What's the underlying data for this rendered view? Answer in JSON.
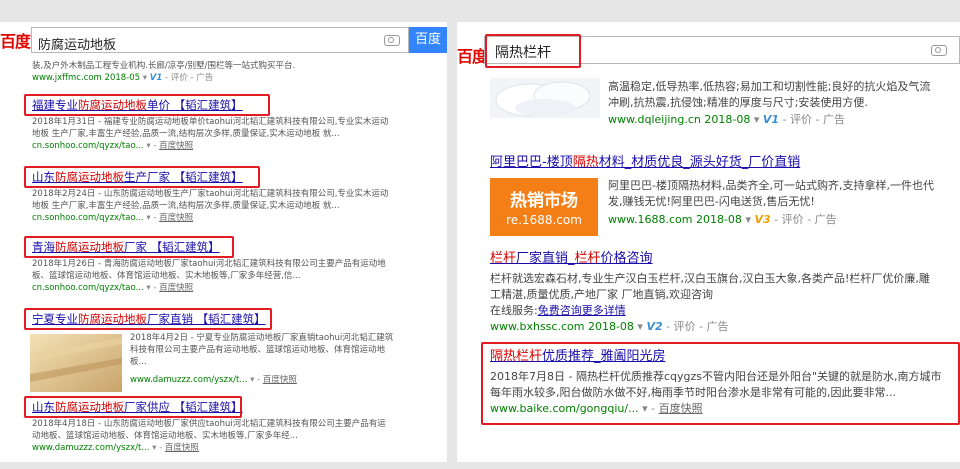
{
  "left": {
    "logo": "百度",
    "query": "防腐运动地板",
    "search_button": "百度一",
    "top_desc": "装,及户外木制品工程专业机构.长廊/凉亭/别墅/围栏等一站式购买平台.",
    "top_url": "www.jxffmc.com",
    "top_date": "2018-05",
    "top_v": "V1",
    "top_extra": "- 评价 - 广告",
    "results": [
      {
        "title_a": "福建专业",
        "title_hl": "防腐运动地板",
        "title_b": "单价 【韬汇建筑】",
        "desc1": "2018年1月31日 - 福建专业防腐运动地板单价taohui河北韬汇建筑科技有限公司,专业实木运动",
        "desc2": "地板 生产厂家,丰富生产经验,品质一流,结构层次多样,质量保证,实木运动地板 就...",
        "url": "cn.sonhoo.com/qyzx/tao...",
        "kz": "百度快照"
      },
      {
        "title_a": "山东",
        "title_hl": "防腐运动地板",
        "title_b": "生产厂家 【韬汇建筑】",
        "desc1": "2018年2月24日 - 山东防腐运动地板生产厂家taohui河北韬汇建筑科技有限公司,专业实木运动",
        "desc2": "地板 生产厂家,丰富生产经验,品质一流,结构层次多样,质量保证,实木运动地板 就...",
        "url": "cn.sonhoo.com/qyzx/tao...",
        "kz": "百度快照"
      },
      {
        "title_a": "青海",
        "title_hl": "防腐运动地板",
        "title_b": "厂家 【韬汇建筑】",
        "desc1": "2018年1月26日 - 青海防腐运动地板厂家taohui河北韬汇建筑科技有限公司主要产品有运动地",
        "desc2": "板、篮球馆运动地板、体育馆运动地板、实木地板等,厂家多年经营,信...",
        "url": "cn.sonhoo.com/qyzx/tao...",
        "kz": "百度快照"
      },
      {
        "title_a": "宁夏专业",
        "title_hl": "防腐运动地板",
        "title_b": "厂家直销 【韬汇建筑】",
        "desc1": "2018年4月2日 - 宁夏专业防腐运动地板厂家直销taohui河北韬汇建筑",
        "desc2": "科技有限公司主要产品有运动地板、篮球馆运动地板、体育馆运动地",
        "desc3": "板...",
        "url": "www.damuzzz.com/yszx/t...",
        "kz": "百度快照"
      },
      {
        "title_a": "山东",
        "title_hl": "防腐运动地板",
        "title_b": "厂家供应 【韬汇建筑】",
        "desc1": "2018年4月18日 - 山东防腐运动地板厂家供应taohui河北韬汇建筑科技有限公司主要产品有运",
        "desc2": "动地板、篮球馆运动地板、体育馆运动地板、实木地板等,厂家多年经...",
        "url": "www.damuzzz.com/yszx/t...",
        "kz": "百度快照"
      }
    ]
  },
  "right": {
    "logo": "百度",
    "query": "隔热栏杆",
    "r0": {
      "desc1": "高温稳定,低导热率,低热容;易加工和切割性能;良好的抗火焰及气流",
      "desc2": "冲刷,抗热震,抗侵蚀;精准的厚度与尺寸;安装使用方便.",
      "url": "www.dqleijing.cn",
      "date": "2018-08",
      "v": "V1",
      "extra": "- 评价 - 广告"
    },
    "r1": {
      "title_a": "阿里巴巴-楼顶",
      "title_hl": "隔热",
      "title_b": "材料_材质优良_源头好货_厂价直销",
      "thumb_line1": "热销市场",
      "thumb_line2": "re.1688.com",
      "desc1": "阿里巴巴-楼顶隔热材料,品类齐全,可一站式购齐,支持拿样,一件也代",
      "desc2": "发,赚钱无忧!阿里巴巴-闪电送货,售后无忧!",
      "url": "www.1688.com",
      "date": "2018-08",
      "v": "V3",
      "extra": "- 评价 - 广告"
    },
    "r2": {
      "title_hl": "栏杆",
      "title_a": "厂家直销_",
      "title_hl2": "栏杆",
      "title_b": "价格咨询",
      "desc1": "栏杆就选宏森石材,专业生产汉白玉栏杆,汉白玉旗台,汉白玉大象,各类产品!栏杆厂优价廉,雕",
      "desc2": "工精湛,质量优质,产地厂家 厂地直销,欢迎咨询",
      "online_label": "在线服务:",
      "online_link": "免费咨询更多详情",
      "url": "www.bxhssc.com",
      "date": "2018-08",
      "v": "V2",
      "extra": "- 评价 - 广告"
    },
    "r3": {
      "title_hl": "隔热栏杆",
      "title_b": "优质推荐_雅阖阳光房",
      "desc1": "2018年7月8日 - 隔热栏杆优质推荐cqygzs不管内阳台还是外阳台\"关键的就是防水,南方城市",
      "desc2": "每年雨水较多,阳台做防水做不好,梅雨季节时阳台渗水是非常有可能的,因此要非常...",
      "url": "www.baike.com/gongqiu/...",
      "kz": "百度快照"
    }
  }
}
